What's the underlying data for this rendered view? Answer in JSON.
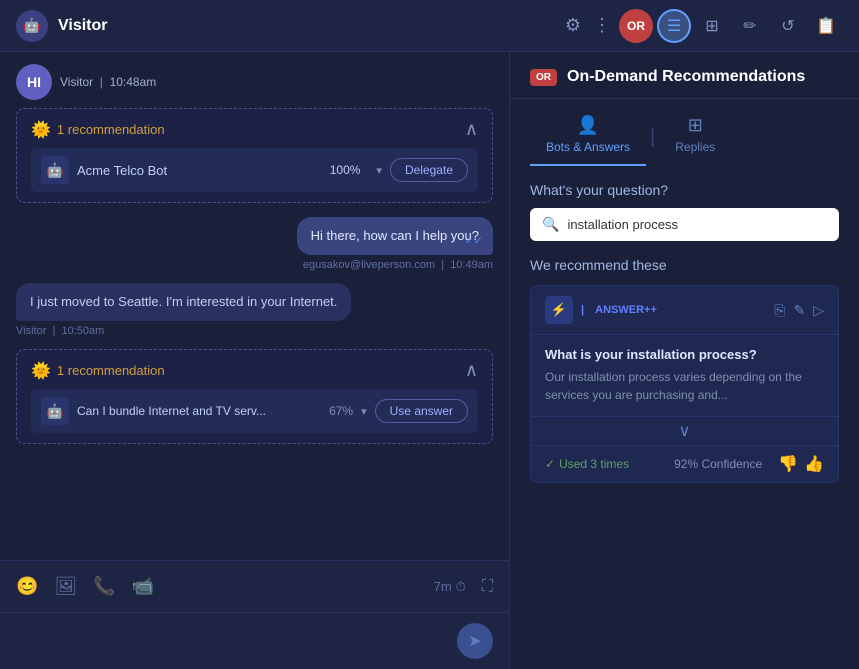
{
  "header": {
    "title": "Visitor",
    "visitor_icon": "🤖",
    "gear_icon": "⚙",
    "more_icon": "⋮",
    "nav": {
      "avatar_label": "OR",
      "icons": [
        "☰",
        "⊞",
        "✏",
        "↺",
        "☰"
      ]
    }
  },
  "chat": {
    "visitor_label": "Visitor",
    "timestamp1": "10:48am",
    "recommendation1": {
      "count_label": "1 recommendation",
      "bot_name": "Acme Telco Bot",
      "percentage": "100%",
      "delegate_label": "Delegate"
    },
    "agent_message": {
      "text": "Hi there, how can I help you?",
      "agent": "egusakov@liveperson.com",
      "time": "10:49am"
    },
    "visitor_message": {
      "text": "I just moved to Seattle. I'm interested in your Internet.",
      "label": "Visitor",
      "time": "10:50am"
    },
    "recommendation2": {
      "count_label": "1 recommendation",
      "answer_text": "Can I bundle Internet and TV serv...",
      "percentage": "67%",
      "use_answer_label": "Use answer"
    },
    "toolbar": {
      "timer": "7m",
      "emoji_icon": "😊",
      "image_icon": "🖼",
      "phone_icon": "📞",
      "video_icon": "📹",
      "clock_icon": "⏱",
      "expand_icon": "⛶"
    },
    "send_icon": "➤"
  },
  "right_panel": {
    "badge_label": "OR",
    "title": "On-Demand Recommendations",
    "tabs": {
      "bots_answers_label": "Bots & Answers",
      "replies_label": "Replies"
    },
    "question_label": "What's your question?",
    "search_placeholder": "installation process",
    "recommend_label": "We recommend these",
    "answer_card": {
      "badge": "ANSWER++",
      "question": "What is your installation process?",
      "answer_text": "Our installation process varies depending on the services you are purchasing and...",
      "used_times": "Used 3 times",
      "confidence": "92% Confidence"
    },
    "icons": {
      "copy": "⎘",
      "edit": "✎",
      "send": "▷"
    }
  }
}
